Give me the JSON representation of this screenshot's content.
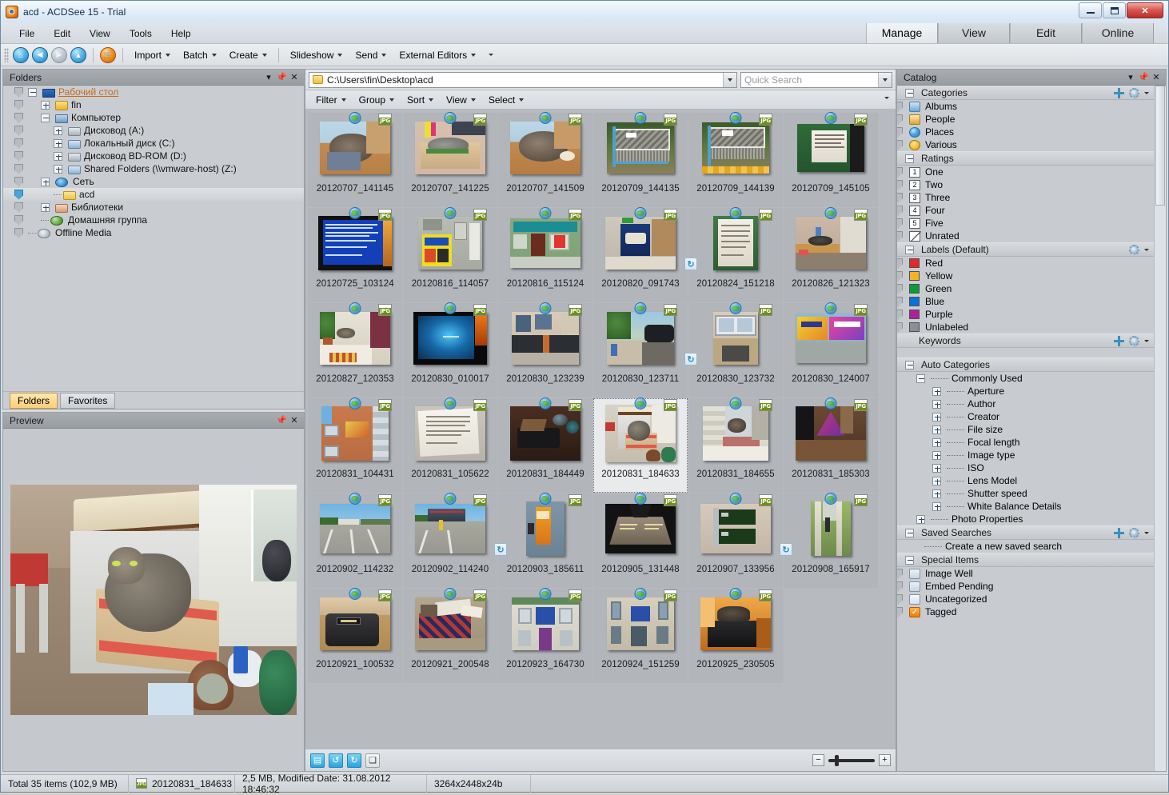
{
  "window": {
    "title": "acd - ACDSee 15 - Trial",
    "minimize": "–",
    "maximize": "□",
    "close": "✕"
  },
  "menu": {
    "items": [
      "File",
      "Edit",
      "View",
      "Tools",
      "Help"
    ]
  },
  "mode_tabs": [
    {
      "label": "Manage",
      "active": true
    },
    {
      "label": "View",
      "active": false
    },
    {
      "label": "Edit",
      "active": false
    },
    {
      "label": "Online",
      "active": false
    }
  ],
  "toolbar": {
    "nav": [
      {
        "name": "home-icon",
        "glyph": "⌂"
      },
      {
        "name": "back-icon",
        "glyph": "◀"
      },
      {
        "name": "forward-icon",
        "glyph": "▶"
      },
      {
        "name": "up-icon",
        "glyph": "▲"
      },
      {
        "name": "acquire-icon",
        "glyph": "🛒"
      }
    ],
    "menus": [
      "Import",
      "Batch",
      "Create",
      "Slideshow",
      "Send",
      "External Editors"
    ]
  },
  "pathbar": {
    "path": "C:\\Users\\fin\\Desktop\\acd",
    "quick_search_placeholder": "Quick Search"
  },
  "filterbar": {
    "items": [
      "Filter",
      "Group",
      "Sort",
      "View",
      "Select"
    ]
  },
  "folders_panel": {
    "title": "Folders",
    "tree": [
      {
        "label": "Рабочий стол",
        "indent": 0,
        "expander": "minus",
        "icon": "ic-desktop",
        "link": true,
        "selected": false,
        "tag": false
      },
      {
        "label": "fin",
        "indent": 1,
        "expander": "plus",
        "icon": "ic-user",
        "link": false,
        "selected": false,
        "tag": false
      },
      {
        "label": "Компьютер",
        "indent": 1,
        "expander": "minus",
        "icon": "ic-comp",
        "link": false,
        "selected": false,
        "tag": false
      },
      {
        "label": "Дисковод (A:)",
        "indent": 2,
        "expander": "plus",
        "icon": "ic-drive",
        "link": false,
        "selected": false,
        "tag": false
      },
      {
        "label": "Локальный диск (C:)",
        "indent": 2,
        "expander": "plus",
        "icon": "ic-disk",
        "link": false,
        "selected": false,
        "tag": false
      },
      {
        "label": "Дисковод BD-ROM (D:)",
        "indent": 2,
        "expander": "plus",
        "icon": "ic-drive",
        "link": false,
        "selected": false,
        "tag": false
      },
      {
        "label": "Shared Folders (\\\\vmware-host) (Z:)",
        "indent": 2,
        "expander": "plus",
        "icon": "ic-disk",
        "link": false,
        "selected": false,
        "tag": false
      },
      {
        "label": "Сеть",
        "indent": 1,
        "expander": "plus",
        "icon": "ic-net",
        "link": false,
        "selected": false,
        "tag": false
      },
      {
        "label": "acd",
        "indent": 2,
        "expander": "none",
        "icon": "ic-folder",
        "link": false,
        "selected": true,
        "tag": true
      },
      {
        "label": "Библиотеки",
        "indent": 1,
        "expander": "plus",
        "icon": "ic-lib",
        "link": false,
        "selected": false,
        "tag": false
      },
      {
        "label": "Домашняя группа",
        "indent": 1,
        "expander": "none",
        "icon": "ic-group",
        "link": false,
        "selected": false,
        "tag": false
      },
      {
        "label": "Offline Media",
        "indent": 0,
        "expander": "none",
        "icon": "ic-offline",
        "link": false,
        "selected": false,
        "tag": false
      }
    ],
    "tabs": [
      {
        "label": "Folders",
        "active": true
      },
      {
        "label": "Favorites",
        "active": false
      }
    ]
  },
  "preview_panel": {
    "title": "Preview"
  },
  "catalog_panel": {
    "title": "Catalog",
    "sections": [
      {
        "name": "Categories",
        "collapsible": true,
        "add": true,
        "gear": true,
        "items": [
          {
            "label": "Albums",
            "icon": "ci-album"
          },
          {
            "label": "People",
            "icon": "ci-people"
          },
          {
            "label": "Places",
            "icon": "ci-places"
          },
          {
            "label": "Various",
            "icon": "ci-various"
          }
        ]
      },
      {
        "name": "Ratings",
        "collapsible": true,
        "add": false,
        "gear": false,
        "items": [
          {
            "label": "One",
            "badge": "1"
          },
          {
            "label": "Two",
            "badge": "2"
          },
          {
            "label": "Three",
            "badge": "3"
          },
          {
            "label": "Four",
            "badge": "4"
          },
          {
            "label": "Five",
            "badge": "5"
          },
          {
            "label": "Unrated",
            "badge": ""
          }
        ]
      },
      {
        "name": "Labels (Default)",
        "collapsible": true,
        "add": false,
        "gear": true,
        "items": [
          {
            "label": "Red",
            "color": "#e02a2a"
          },
          {
            "label": "Yellow",
            "color": "#f5b229"
          },
          {
            "label": "Green",
            "color": "#0d9b39"
          },
          {
            "label": "Blue",
            "color": "#0a74d6"
          },
          {
            "label": "Purple",
            "color": "#b0209b"
          },
          {
            "label": "Unlabeled",
            "color": "#8a8f94"
          }
        ]
      }
    ],
    "keywords": {
      "label": "Keywords"
    },
    "auto_categories": {
      "title": "Auto Categories",
      "commonly_used": "Commonly Used",
      "items": [
        "Aperture",
        "Author",
        "Creator",
        "File size",
        "Focal length",
        "Image type",
        "ISO",
        "Lens Model",
        "Shutter speed",
        "White Balance Details"
      ],
      "photo_properties": "Photo Properties"
    },
    "saved_searches": {
      "title": "Saved Searches",
      "create": "Create a new saved search"
    },
    "special_items": {
      "title": "Special Items",
      "items": [
        {
          "label": "Image Well",
          "kind": "well"
        },
        {
          "label": "Embed Pending",
          "kind": "embed"
        },
        {
          "label": "Uncategorized",
          "kind": "uncat"
        },
        {
          "label": "Tagged",
          "kind": "tagged"
        }
      ]
    }
  },
  "thumbnails": [
    {
      "name": "20120707_141145",
      "type": "JPG",
      "rotate": false,
      "selected": false,
      "scene": "cat-blanket"
    },
    {
      "name": "20120707_141225",
      "type": "JPG",
      "rotate": false,
      "selected": false,
      "scene": "cat-box"
    },
    {
      "name": "20120707_141509",
      "type": "JPG",
      "rotate": false,
      "selected": false,
      "scene": "cat-blanket2"
    },
    {
      "name": "20120709_144135",
      "type": "JPG",
      "rotate": false,
      "selected": false,
      "scene": "bench"
    },
    {
      "name": "20120709_144139",
      "type": "JPG",
      "rotate": false,
      "selected": false,
      "scene": "bench2"
    },
    {
      "name": "20120709_145105",
      "type": "JPG",
      "rotate": false,
      "selected": false,
      "scene": "green-notice"
    },
    {
      "name": "20120725_103124",
      "type": "JPG",
      "rotate": false,
      "selected": false,
      "scene": "bsod"
    },
    {
      "name": "20120816_114057",
      "type": "JPG",
      "rotate": false,
      "selected": false,
      "scene": "yellow-shop"
    },
    {
      "name": "20120816_115124",
      "type": "JPG",
      "rotate": false,
      "selected": false,
      "scene": "teal-shop"
    },
    {
      "name": "20120820_091743",
      "type": "JPG",
      "rotate": false,
      "selected": false,
      "scene": "box-product"
    },
    {
      "name": "20120824_151218",
      "type": "JPG",
      "rotate": true,
      "selected": false,
      "scene": "paper-green"
    },
    {
      "name": "20120826_121323",
      "type": "JPG",
      "rotate": false,
      "selected": false,
      "scene": "room-cat"
    },
    {
      "name": "20120827_120353",
      "type": "JPG",
      "rotate": false,
      "selected": false,
      "scene": "window-plant"
    },
    {
      "name": "20120830_010017",
      "type": "JPG",
      "rotate": false,
      "selected": false,
      "scene": "monitor-blue"
    },
    {
      "name": "20120830_123239",
      "type": "JPG",
      "rotate": false,
      "selected": false,
      "scene": "street-wall"
    },
    {
      "name": "20120830_123711",
      "type": "JPG",
      "rotate": false,
      "selected": false,
      "scene": "street-car"
    },
    {
      "name": "20120830_123732",
      "type": "JPG",
      "rotate": true,
      "selected": false,
      "scene": "shopfront"
    },
    {
      "name": "20120830_124007",
      "type": "JPG",
      "rotate": false,
      "selected": false,
      "scene": "billboard"
    },
    {
      "name": "20120831_104431",
      "type": "JPG",
      "rotate": false,
      "selected": false,
      "scene": "orange-building"
    },
    {
      "name": "20120831_105622",
      "type": "JPG",
      "rotate": false,
      "selected": false,
      "scene": "documents"
    },
    {
      "name": "20120831_184449",
      "type": "JPG",
      "rotate": false,
      "selected": false,
      "scene": "dark-desk"
    },
    {
      "name": "20120831_184633",
      "type": "JPG",
      "rotate": false,
      "selected": true,
      "scene": "cat-stool"
    },
    {
      "name": "20120831_184655",
      "type": "JPG",
      "rotate": false,
      "selected": false,
      "scene": "cat-windowsill"
    },
    {
      "name": "20120831_185303",
      "type": "JPG",
      "rotate": false,
      "selected": false,
      "scene": "desk-lamp"
    },
    {
      "name": "20120902_114232",
      "type": "JPG",
      "rotate": false,
      "selected": false,
      "scene": "parking"
    },
    {
      "name": "20120902_114240",
      "type": "JPG",
      "rotate": false,
      "selected": false,
      "scene": "parking2"
    },
    {
      "name": "20120903_185611",
      "type": "JPG",
      "rotate": true,
      "selected": false,
      "scene": "juice-box"
    },
    {
      "name": "20120905_131448",
      "type": "JPG",
      "rotate": false,
      "selected": false,
      "scene": "monument"
    },
    {
      "name": "20120907_133956",
      "type": "JPG",
      "rotate": false,
      "selected": false,
      "scene": "pci-card"
    },
    {
      "name": "20120908_165917",
      "type": "JPG",
      "rotate": true,
      "selected": false,
      "scene": "tree-walk"
    },
    {
      "name": "20120921_100532",
      "type": "JPG",
      "rotate": false,
      "selected": false,
      "scene": "bag-table"
    },
    {
      "name": "20120921_200548",
      "type": "JPG",
      "rotate": false,
      "selected": false,
      "scene": "bed-mess"
    },
    {
      "name": "20120923_164730",
      "type": "JPG",
      "rotate": false,
      "selected": false,
      "scene": "white-building"
    },
    {
      "name": "20120924_151259",
      "type": "JPG",
      "rotate": false,
      "selected": false,
      "scene": "beige-building"
    },
    {
      "name": "20120925_230505",
      "type": "JPG",
      "rotate": false,
      "selected": false,
      "scene": "cat-monitor"
    }
  ],
  "bottombar": {
    "buttons": [
      "add-to-image-well",
      "rotate-left",
      "rotate-right",
      "compare"
    ],
    "zoom_minus": "−",
    "zoom_plus": "+"
  },
  "statusbar": {
    "total": "Total 35 items  (102,9 MB)",
    "selected_file": "20120831_184633",
    "file_info": "2,5 MB, Modified Date: 31.08.2012 18:46:32",
    "dimensions": "3264x2448x24b"
  }
}
